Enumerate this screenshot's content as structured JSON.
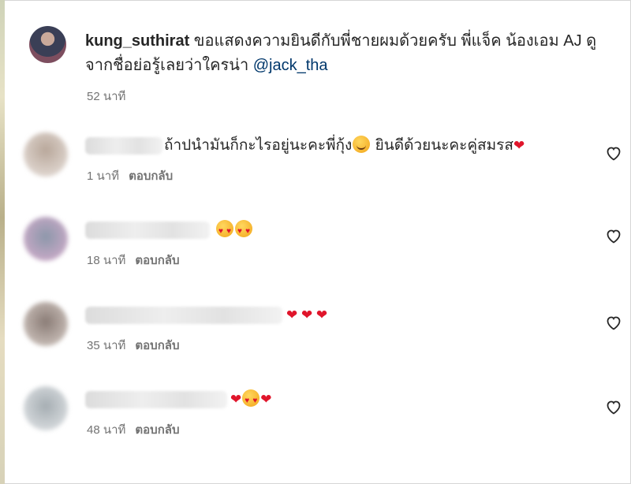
{
  "caption": {
    "username": "kung_suthirat",
    "text": " ขอแสดงความยินดีกับพี่ชายผมด้วยครับ พี่แจ็ค น้องเอม AJ ดูจากชื่อย่อรู้เลยว่าใครน่า ",
    "mention": "@jack_tha",
    "time": "52 นาที"
  },
  "comments": [
    {
      "text": "ถ้าปนำมันก็กะไรอยู่นะคะพี่กุ้ง",
      "text2": " ยินดีด้วยนะคะคู่สมรส",
      "time": "1 นาที",
      "reply": "ตอบกลับ",
      "avatar_color": "#cfc2b8"
    },
    {
      "text": "",
      "time": "18 นาที",
      "reply": "ตอบกลับ",
      "avatar_color": "#9fa8b8"
    },
    {
      "text": "",
      "time": "35 นาที",
      "reply": "ตอบกลับ",
      "avatar_color": "#9d8f88"
    },
    {
      "text": "",
      "time": "48 นาที",
      "reply": "ตอบกลับ",
      "avatar_color": "#b7bcc0"
    }
  ],
  "icons": {
    "heart_outline": "heart-outline-icon",
    "heart_emoji": "red-heart-emoji-icon",
    "heart_eyes_emoji": "heart-eyes-emoji-icon",
    "smile_emoji": "smiling-face-emoji-icon"
  },
  "colors": {
    "mention": "#00376b",
    "meta": "#737373",
    "heart": "#e0152b"
  }
}
